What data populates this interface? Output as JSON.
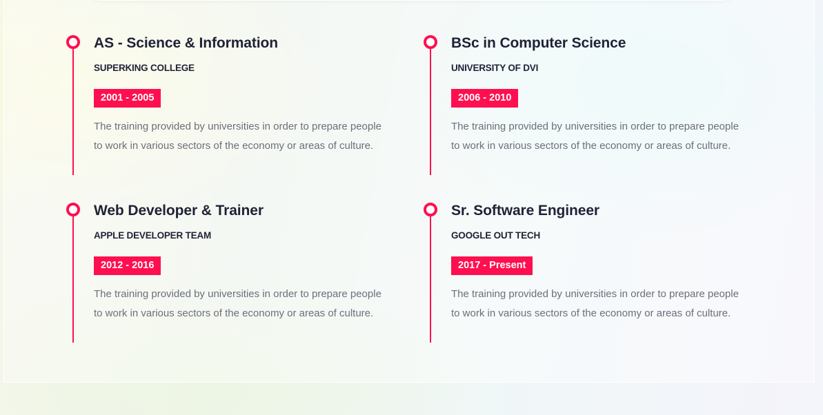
{
  "accent_color": "#ff0f4f",
  "education": [
    {
      "degree": "AS - Science & Information",
      "institution": "SUPERKING COLLEGE",
      "years": "2001 - 2005",
      "description": "The training provided by universities in order to prepare people to work in various sectors of the economy or areas of culture."
    },
    {
      "degree": "BSc in Computer Science",
      "institution": "UNIVERSITY OF DVI",
      "years": "2006 - 2010",
      "description": "The training provided by universities in order to prepare people to work in various sectors of the economy or areas of culture."
    },
    {
      "degree": "Web Developer & Trainer",
      "institution": "APPLE DEVELOPER TEAM",
      "years": "2012 - 2016",
      "description": "The training provided by universities in order to prepare people to work in various sectors of the economy or areas of culture."
    },
    {
      "degree": "Sr. Software Engineer",
      "institution": "GOOGLE OUT TECH",
      "years": "2017 - Present",
      "description": "The training provided by universities in order to prepare people to work in various sectors of the economy or areas of culture."
    }
  ]
}
